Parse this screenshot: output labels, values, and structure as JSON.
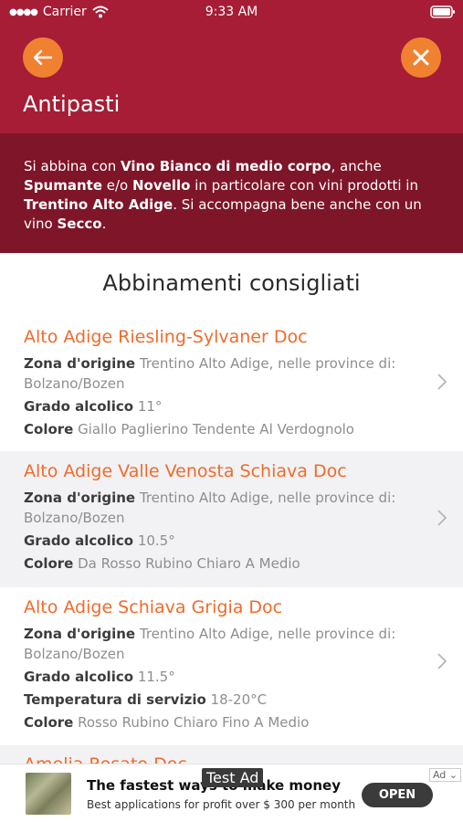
{
  "status_bar": {
    "carrier": "Carrier",
    "time": "9:33 AM"
  },
  "header": {
    "title": "Antipasti",
    "back_icon": "arrow-left-icon",
    "close_icon": "close-icon"
  },
  "description": {
    "p1": "Si abbina con ",
    "b1": "Vino Bianco di medio corpo",
    "p2": ", anche ",
    "b2": "Spumante",
    "p3": " e/o ",
    "b3": "Novello",
    "p4": " in particolare con vini prodotti in ",
    "b4": "Trentino Alto Adige",
    "p5": ". Si accompagna bene anche con un vino ",
    "b5": "Secco",
    "p6": "."
  },
  "section_title": "Abbinamenti consigliati",
  "labels": {
    "zona": "Zona d'origine",
    "grado": "Grado alcolico",
    "temp": "Temperatura di servizio",
    "colore": "Colore"
  },
  "wines": [
    {
      "name": "Alto Adige Riesling-Sylvaner Doc",
      "zona": "Trentino Alto Adige, nelle province di: Bolzano/Bozen",
      "grado": "11°",
      "colore": "Giallo Paglierino Tendente Al Verdognolo"
    },
    {
      "name": "Alto Adige Valle Venosta Schiava Doc",
      "zona": "Trentino Alto Adige, nelle province di: Bolzano/Bozen",
      "grado": "10.5°",
      "colore": "Da Rosso Rubino Chiaro A Medio"
    },
    {
      "name": "Alto Adige Schiava Grigia Doc",
      "zona": "Trentino Alto Adige, nelle province di: Bolzano/Bozen",
      "grado": "11.5°",
      "temperatura": "18-20°C",
      "colore": "Rosso Rubino Chiaro Fino A Medio"
    }
  ],
  "partial_wine": "Amelia Rosato Doc",
  "ad": {
    "title": "The fastest ways to make money",
    "subtitle": "Best applications for profit over $ 300 per month",
    "test_label": "Test Ad",
    "open_label": "OPEN",
    "badge": "Ad"
  },
  "colors": {
    "header": "#a61d35",
    "desc_bg": "#7e1528",
    "accent": "#f08131",
    "wine_name": "#f06b2b"
  }
}
